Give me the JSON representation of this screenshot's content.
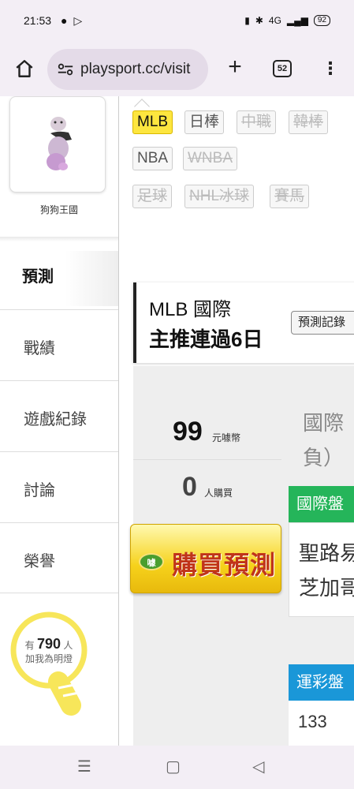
{
  "status": {
    "time": "21:53",
    "battery": "92",
    "network": "4G"
  },
  "browser": {
    "url": "playsport.cc/visit",
    "tab_count": "52"
  },
  "sidebar": {
    "user_name": "狗狗王國",
    "active_item": "預測",
    "items": [
      {
        "label": "戰績"
      },
      {
        "label": "遊戲紀錄"
      },
      {
        "label": "討論"
      },
      {
        "label": "榮譽"
      }
    ],
    "fans_prefix": "有",
    "fans_count": "790",
    "fans_unit": "人",
    "fans_suffix": "加我為明燈"
  },
  "leagues": [
    {
      "label": "MLB",
      "state": "active"
    },
    {
      "label": "日棒",
      "state": "normal"
    },
    {
      "label": "中職",
      "state": "off"
    },
    {
      "label": "韓棒",
      "state": "off"
    },
    {
      "label": "NBA",
      "state": "normal"
    },
    {
      "label": "WNBA",
      "state": "off"
    },
    {
      "label": "足球",
      "state": "off"
    },
    {
      "label": "NHL冰球",
      "state": "off"
    },
    {
      "label": "賽馬",
      "state": "off"
    }
  ],
  "card": {
    "line1": "MLB 國際",
    "line2": "主推連過6日",
    "record_button": "預測記錄"
  },
  "price": {
    "amount": "99",
    "unit": "元噱幣",
    "buyers": "0",
    "buyers_unit": "人購買"
  },
  "buy": {
    "badge": "噱",
    "label": "購買預測"
  },
  "detail": {
    "desc_l1": "國際",
    "desc_l2": "負）",
    "green_tab": "國際盤",
    "match_l1": "聖路易",
    "match_l2": "芝加哥",
    "blue_tab": "運彩盤",
    "number": "133"
  },
  "navbar": {
    "recents": "☰",
    "home": "▢",
    "back": "◁"
  }
}
